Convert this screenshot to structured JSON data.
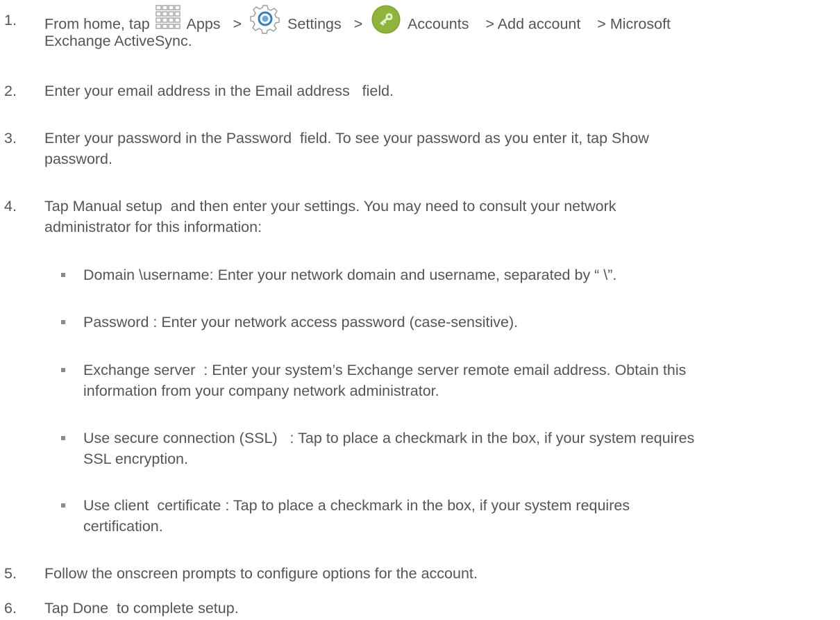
{
  "steps": [
    {
      "num": "1.",
      "lines": [
        {
          "prefix": "From home, tap",
          "apps_label": "Apps",
          "sep1": ">",
          "settings_label": "Settings",
          "sep2": ">",
          "accounts_label": "Accounts",
          "sep3": "> Add account",
          "sep4": "> Microsoft"
        },
        {
          "text": "Exchange ActiveSync."
        }
      ]
    },
    {
      "num": "2.",
      "lines": [
        {
          "text": "Enter your email address in the Email address   field."
        }
      ]
    },
    {
      "num": "3.",
      "lines": [
        {
          "text": "Enter your password in the Password  field. To see your password as you enter it, tap Show"
        },
        {
          "text": "password."
        }
      ]
    },
    {
      "num": "4.",
      "lines": [
        {
          "text": "Tap Manual setup  and then enter your settings. You may need to consult your network"
        },
        {
          "text": "administrator for this information:"
        }
      ]
    },
    {
      "num": "5.",
      "lines": [
        {
          "text": "Follow the onscreen prompts to configure options for the account."
        }
      ]
    },
    {
      "num": "6.",
      "lines": [
        {
          "text": "Tap Done  to complete setup."
        }
      ]
    }
  ],
  "substeps": [
    {
      "lines": [
        {
          "text": "Domain \\username: Enter your network domain and username, separated by “ \\”."
        }
      ]
    },
    {
      "lines": [
        {
          "text": "Password : Enter your network access password (case-sensitive)."
        }
      ]
    },
    {
      "lines": [
        {
          "text": "Exchange server  : Enter your system’s Exchange server remote email address. Obtain this"
        },
        {
          "text": "information from your company network administrator."
        }
      ]
    },
    {
      "lines": [
        {
          "text": "Use secure connection (SSL)   : Tap to place a checkmark in the box, if your system requires"
        },
        {
          "text": "SSL encryption."
        }
      ]
    },
    {
      "lines": [
        {
          "text": "Use client  certificate : Tap to place a checkmark in the box, if your system requires"
        },
        {
          "text": "certification."
        }
      ]
    }
  ],
  "icons": {
    "apps": "apps-grid-icon",
    "settings": "settings-gear-icon",
    "accounts": "accounts-key-icon"
  },
  "colors": {
    "text": "#555555",
    "bullet": "#8a8a8a",
    "accounts_icon": "#8fb43c",
    "settings_icon_ring": "#2f7fc4"
  }
}
